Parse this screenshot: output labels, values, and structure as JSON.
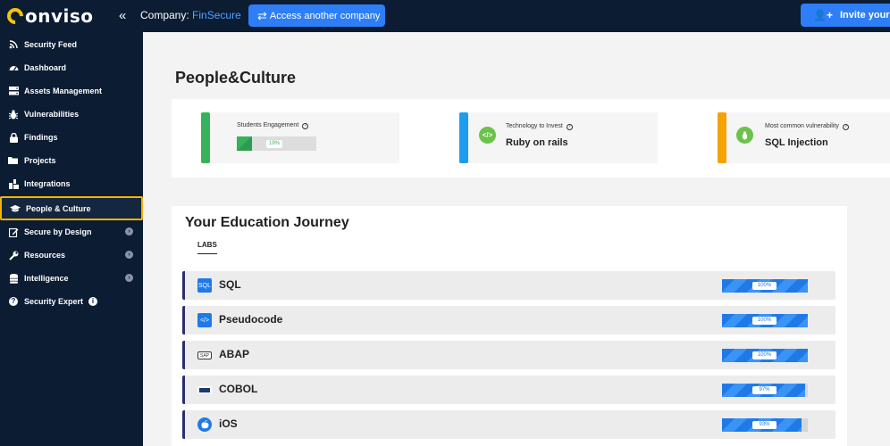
{
  "header": {
    "logo_text": "onviso",
    "collapse_glyph": "«",
    "company_label": "Company:",
    "company_name": "FinSecure",
    "access_button": "Access another company",
    "invite_button": "Invite your te"
  },
  "sidebar": {
    "items": [
      {
        "label": "Security Feed",
        "icon": "rss-icon"
      },
      {
        "label": "Dashboard",
        "icon": "gauge-icon"
      },
      {
        "label": "Assets Management",
        "icon": "server-icon"
      },
      {
        "label": "Vulnerabilities",
        "icon": "bug-icon"
      },
      {
        "label": "Findings",
        "icon": "lock-icon"
      },
      {
        "label": "Projects",
        "icon": "folder-icon"
      },
      {
        "label": "Integrations",
        "icon": "puzzle-icon"
      },
      {
        "label": "People & Culture",
        "icon": "graduation-cap-icon"
      },
      {
        "label": "Secure by Design",
        "icon": "edit-icon"
      },
      {
        "label": "Resources",
        "icon": "wrench-icon"
      },
      {
        "label": "Intelligence",
        "icon": "database-icon"
      },
      {
        "label": "Security Expert",
        "icon": "question-icon"
      }
    ],
    "active_index": 7
  },
  "main": {
    "title": "People&Culture",
    "stats": [
      {
        "label": "Students Engagement",
        "progress_percent": 19,
        "progress_text": "19%",
        "color": "#36b35a"
      },
      {
        "label": "Technology to Invest",
        "value": "Ruby on rails",
        "color": "#1e9bf0",
        "icon": "code-icon"
      },
      {
        "label": "Most common vulnerability",
        "value": "SQL Injection",
        "color": "#f4a300",
        "icon": "bug-icon"
      }
    ],
    "journey": {
      "title": "Your Education Journey",
      "tab": "LABS",
      "labs": [
        {
          "name": "SQL",
          "percent": 100,
          "percent_text": "100%",
          "icon": "sql-file-icon"
        },
        {
          "name": "Pseudocode",
          "percent": 100,
          "percent_text": "100%",
          "icon": "code-file-icon"
        },
        {
          "name": "ABAP",
          "percent": 100,
          "percent_text": "100%",
          "icon": "abap-icon"
        },
        {
          "name": "COBOL",
          "percent": 97,
          "percent_text": "97%",
          "icon": "cobol-icon"
        },
        {
          "name": "iOS",
          "percent": 93,
          "percent_text": "93%",
          "icon": "apple-icon"
        }
      ]
    }
  }
}
